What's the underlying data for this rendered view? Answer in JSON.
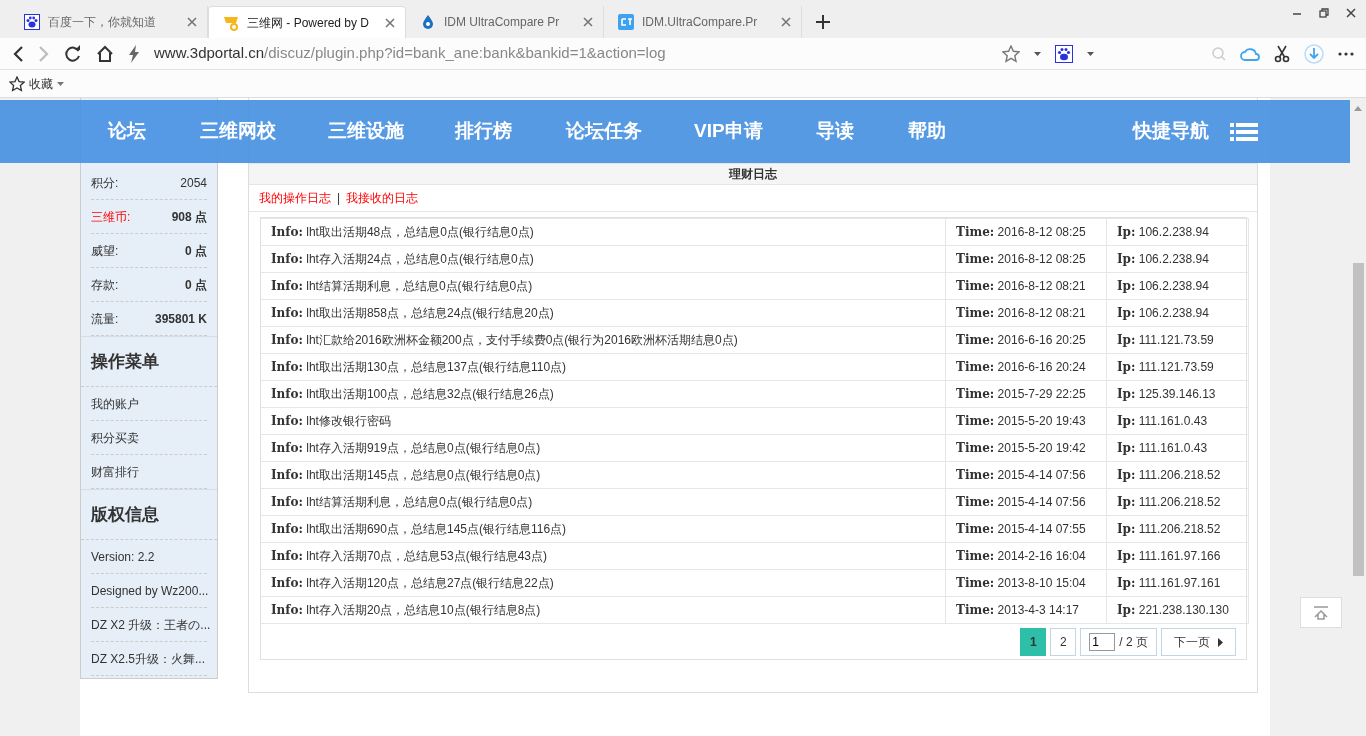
{
  "browser": {
    "tabs": [
      {
        "title": "百度一下，你就知道",
        "selected": false
      },
      {
        "title": "三维网 - Powered by D",
        "selected": true
      },
      {
        "title": "IDM UltraCompare Pr",
        "selected": false
      },
      {
        "title": "IDM.UltraCompare.Pr",
        "selected": false
      }
    ],
    "url_host": "www.3dportal.cn",
    "url_path": "/discuz/plugin.php?id=bank_ane:bank&bankid=1&action=log",
    "bookmarks_label": "收藏"
  },
  "nav": {
    "items": [
      "论坛",
      "三维网校",
      "三维设施",
      "排行榜",
      "论坛任务",
      "VIP申请",
      "导读",
      "帮助"
    ],
    "quick_nav": "快捷导航"
  },
  "sidebar": {
    "user_rows": [
      {
        "label": "积分:",
        "value": "2054",
        "highlight": false,
        "bold": false
      },
      {
        "label": "三维币:",
        "value": "908 点",
        "highlight": true,
        "bold": true
      },
      {
        "label": "威望:",
        "value": "0 点",
        "highlight": false,
        "bold": true
      },
      {
        "label": "存款:",
        "value": "0 点",
        "highlight": false,
        "bold": true
      },
      {
        "label": "流量:",
        "value": "395801 K",
        "highlight": false,
        "bold": true
      }
    ],
    "sections": [
      {
        "title": "操作菜单",
        "items": [
          "我的账户",
          "积分买卖",
          "财富排行"
        ]
      },
      {
        "title": "版权信息",
        "items": [
          "Version: 2.2",
          "Designed by Wz200...",
          "DZ X2 升级：王者の...",
          "DZ X2.5升级：火舞..."
        ]
      }
    ]
  },
  "log": {
    "title": "理财日志",
    "filters": [
      "我的操作日志",
      "我接收的日志"
    ],
    "filter_separator": "|",
    "rows": [
      {
        "info": "**Info:** lht取出活期48点，总结息0点(银行结息0点)",
        "time": "**Time:** 2016-8-12 08:25",
        "ip": "**Ip:** 106.2.238.94"
      },
      {
        "info": "**Info:** lht存入活期24点，总结息0点(银行结息0点)",
        "time": "**Time:** 2016-8-12 08:25",
        "ip": "**Ip:** 106.2.238.94"
      },
      {
        "info": "**Info:** lht结算活期利息，总结息0点(银行结息0点)",
        "time": "**Time:** 2016-8-12 08:21",
        "ip": "**Ip:** 106.2.238.94"
      },
      {
        "info": "**Info:** lht取出活期858点，总结息24点(银行结息20点)",
        "time": "**Time:** 2016-8-12 08:21",
        "ip": "**Ip:** 106.2.238.94"
      },
      {
        "info": "**Info:** lht汇款给2016欧洲杯金额200点，支付手续费0点(银行为2016欧洲杯活期结息0点)",
        "time": "**Time:** 2016-6-16 20:25",
        "ip": "**Ip:** 111.121.73.59"
      },
      {
        "info": "**Info:** lht取出活期130点，总结息137点(银行结息110点)",
        "time": "**Time:** 2016-6-16 20:24",
        "ip": "**Ip:** 111.121.73.59"
      },
      {
        "info": "**Info:** lht取出活期100点，总结息32点(银行结息26点)",
        "time": "**Time:** 2015-7-29 22:25",
        "ip": "**Ip:** 125.39.146.13"
      },
      {
        "info": "**Info:** lht修改银行密码",
        "time": "**Time:** 2015-5-20 19:43",
        "ip": "**Ip:** 111.161.0.43"
      },
      {
        "info": "**Info:** lht存入活期919点，总结息0点(银行结息0点)",
        "time": "**Time:** 2015-5-20 19:42",
        "ip": "**Ip:** 111.161.0.43"
      },
      {
        "info": "**Info:** lht取出活期145点，总结息0点(银行结息0点)",
        "time": "**Time:** 2015-4-14 07:56",
        "ip": "**Ip:** 111.206.218.52"
      },
      {
        "info": "**Info:** lht结算活期利息，总结息0点(银行结息0点)",
        "time": "**Time:** 2015-4-14 07:56",
        "ip": "**Ip:** 111.206.218.52"
      },
      {
        "info": "**Info:** lht取出活期690点，总结息145点(银行结息116点)",
        "time": "**Time:** 2015-4-14 07:55",
        "ip": "**Ip:** 111.206.218.52"
      },
      {
        "info": "**Info:** lht存入活期70点，总结息53点(银行结息43点)",
        "time": "**Time:** 2014-2-16 16:04",
        "ip": "**Ip:** 111.161.97.166"
      },
      {
        "info": "**Info:** lht存入活期120点，总结息27点(银行结息22点)",
        "time": "**Time:** 2013-8-10 15:04",
        "ip": "**Ip:** 111.161.97.161"
      },
      {
        "info": "**Info:** lht存入活期20点，总结息10点(银行结息8点)",
        "time": "**Time:** 2013-4-3 14:17",
        "ip": "**Ip:** 221.238.130.130"
      }
    ],
    "pages": [
      {
        "label": "1",
        "selected": true
      },
      {
        "label": "2",
        "selected": false
      }
    ],
    "page_input": "1",
    "page_total": "/ 2 页",
    "next": "下一页"
  }
}
